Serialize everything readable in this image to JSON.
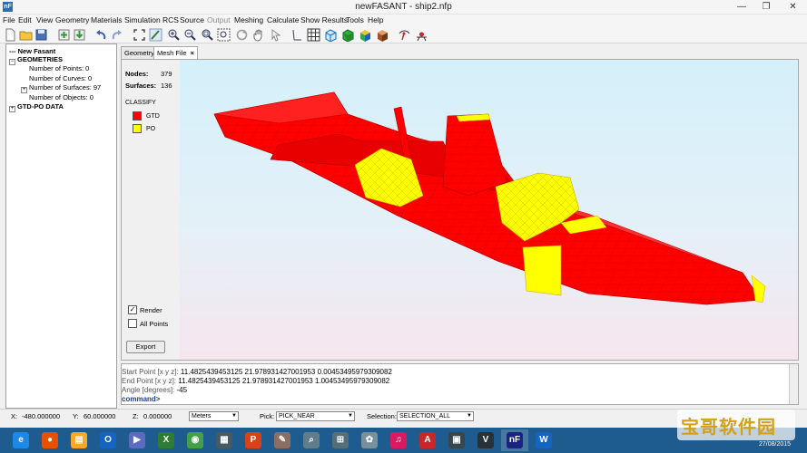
{
  "window": {
    "title": "newFASANT - ship2.nfp",
    "app_icon": "fasant-app-icon"
  },
  "menu": [
    {
      "label": "File",
      "enabled": true
    },
    {
      "label": "Edit",
      "enabled": true
    },
    {
      "label": "View",
      "enabled": true
    },
    {
      "label": "Geometry",
      "enabled": true
    },
    {
      "label": "Materials",
      "enabled": true
    },
    {
      "label": "Simulation",
      "enabled": true
    },
    {
      "label": "RCS",
      "enabled": true
    },
    {
      "label": "Source",
      "enabled": true
    },
    {
      "label": "Output",
      "enabled": false
    },
    {
      "label": "Meshing",
      "enabled": true
    },
    {
      "label": "Calculate",
      "enabled": true
    },
    {
      "label": "Show Results",
      "enabled": true
    },
    {
      "label": "Tools",
      "enabled": true
    },
    {
      "label": "Help",
      "enabled": true
    }
  ],
  "toolbar_icons": [
    "new-file-icon",
    "open-folder-icon",
    "save-icon",
    "add-icon",
    "import-icon",
    "undo-icon",
    "redo-icon",
    "fit-view-icon",
    "pick-icon",
    "zoom-in-icon",
    "zoom-out-icon",
    "zoom-window-icon",
    "zoom-extents-icon",
    "rotate-icon",
    "pan-hand-icon",
    "select-arrow-icon",
    "line-icon",
    "grid-icon",
    "wireframe-cube-icon",
    "solid-cube-green-icon",
    "solid-cube-color-icon",
    "solid-cube-brown-icon",
    "source-icon",
    "observer-icon"
  ],
  "tree": {
    "root": "--- New Fasant",
    "geometries": {
      "label": "GEOMETRIES",
      "points": "Number of Points: 0",
      "curves": "Number of Curves: 0",
      "surfaces": "Number of Surfaces: 97",
      "objects": "Number of Objects: 0"
    },
    "gtd": "GTD-PO DATA"
  },
  "tabs": [
    {
      "label": "Geometry",
      "active": false
    },
    {
      "label": "Mesh File",
      "active": true,
      "close": "×"
    }
  ],
  "mesh": {
    "nodes_label": "Nodes:",
    "nodes_value": "379",
    "surfaces_label": "Surfaces:",
    "surfaces_value": "136",
    "classify_label": "CLASSIFY",
    "legend": [
      {
        "label": "GTD",
        "color": "#ff0000"
      },
      {
        "label": "PO",
        "color": "#ffff00"
      }
    ],
    "render_label": "Render",
    "render_checked": true,
    "all_points_label": "All Points",
    "all_points_checked": false,
    "export_label": "Export"
  },
  "console": {
    "start_label": "Start Point [x y z]:",
    "start_value": "11.4825439453125 21.978931427001953 0.00453495979309082",
    "end_label": "End Point [x y z]:",
    "end_value": "11.4825439453125 21.978931427001953 1.00453495979309082",
    "angle_label": "Angle [degrees]:",
    "angle_value": "-45",
    "prompt": "command>"
  },
  "status": {
    "x_label": "X:",
    "x_value": "-480.000000",
    "y_label": "Y:",
    "y_value": "60.000000",
    "z_label": "Z:",
    "z_value": "0.000000",
    "units": "Meters",
    "pick_label": "Pick:",
    "pick_value": "PICK_NEAR",
    "selection_label": "Selection:",
    "selection_value": "SELECTION_ALL"
  },
  "taskbar": {
    "apps": [
      {
        "name": "internet-explorer-icon",
        "glyph": "e",
        "color": "#1e88e5"
      },
      {
        "name": "firefox-icon",
        "glyph": "●",
        "color": "#e65100"
      },
      {
        "name": "file-explorer-icon",
        "glyph": "▤",
        "color": "#f9a825"
      },
      {
        "name": "outlook-icon",
        "glyph": "O",
        "color": "#1565c0"
      },
      {
        "name": "media-player-icon",
        "glyph": "▶",
        "color": "#5c6bc0"
      },
      {
        "name": "excel-icon",
        "glyph": "X",
        "color": "#2e7d32"
      },
      {
        "name": "chrome-icon",
        "glyph": "◉",
        "color": "#43a047"
      },
      {
        "name": "store-icon",
        "glyph": "▦",
        "color": "#455a64"
      },
      {
        "name": "powerpoint-icon",
        "glyph": "P",
        "color": "#d84315"
      },
      {
        "name": "tool-icon",
        "glyph": "✎",
        "color": "#8d6e63"
      },
      {
        "name": "search-app-icon",
        "glyph": "⌕",
        "color": "#607d8b"
      },
      {
        "name": "network-app-icon",
        "glyph": "⊞",
        "color": "#546e7a"
      },
      {
        "name": "sticky-app-icon",
        "glyph": "✿",
        "color": "#78909c"
      },
      {
        "name": "itunes-icon",
        "glyph": "♫",
        "color": "#d81b60"
      },
      {
        "name": "acrobat-icon",
        "glyph": "A",
        "color": "#c62828"
      },
      {
        "name": "calculator-icon",
        "glyph": "▣",
        "color": "#37474f"
      },
      {
        "name": "vnc-icon",
        "glyph": "V",
        "color": "#263238"
      },
      {
        "name": "newfasant-icon",
        "glyph": "nF",
        "color": "#1a237e"
      },
      {
        "name": "word-icon",
        "glyph": "W",
        "color": "#1565c0"
      }
    ],
    "clock_date": "27/08/2015"
  },
  "watermark": {
    "text": "宝哥软件园"
  },
  "colors": {
    "gtd": "#ff0000",
    "po": "#ffff00",
    "taskbar": "#1e5b8e"
  }
}
